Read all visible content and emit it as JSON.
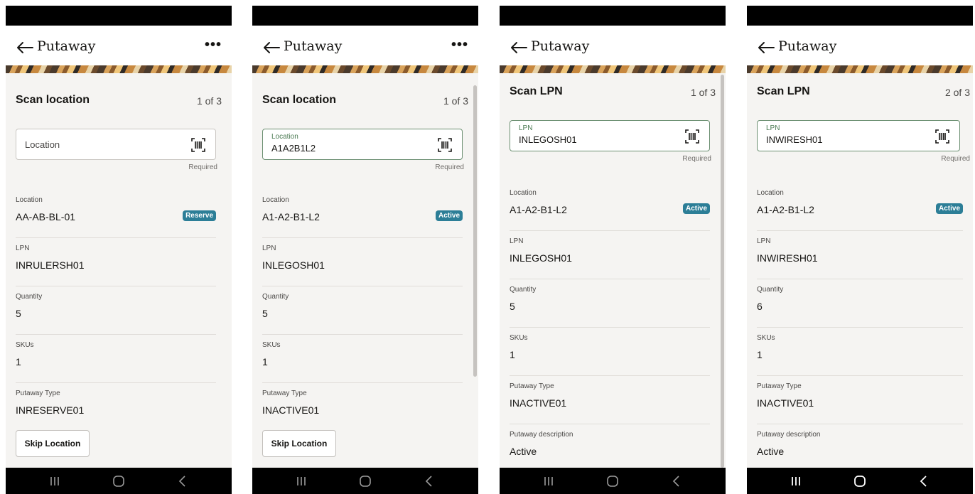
{
  "screens": [
    {
      "header_title": "Putaway",
      "step_title": "Scan location",
      "step_count": "1 of 3",
      "field_placeholder": "Location",
      "field_label": "",
      "field_value": "",
      "required_text": "Required",
      "details": [
        {
          "label": "Location",
          "value": "AA-AB-BL-01",
          "badge": "Reserve"
        },
        {
          "label": "LPN",
          "value": "INRULERSH01"
        },
        {
          "label": "Quantity",
          "value": "5"
        },
        {
          "label": "SKUs",
          "value": "1"
        },
        {
          "label": "Putaway Type",
          "value": "INRESERVE01"
        }
      ],
      "skip_label": "Skip Location"
    },
    {
      "header_title": "Putaway",
      "step_title": "Scan location",
      "step_count": "1 of 3",
      "field_placeholder": "",
      "field_label": "Location",
      "field_value": "A1A2B1L2",
      "required_text": "Required",
      "details": [
        {
          "label": "Location",
          "value": "A1-A2-B1-L2",
          "badge": "Active"
        },
        {
          "label": "LPN",
          "value": "INLEGOSH01"
        },
        {
          "label": "Quantity",
          "value": "5"
        },
        {
          "label": "SKUs",
          "value": "1"
        },
        {
          "label": "Putaway Type",
          "value": "INACTIVE01"
        }
      ],
      "skip_label": "Skip Location"
    },
    {
      "header_title": "Putaway",
      "step_title": "Scan LPN",
      "step_count": "1 of 3",
      "field_placeholder": "",
      "field_label": "LPN",
      "field_value": "INLEGOSH01",
      "required_text": "Required",
      "details": [
        {
          "label": "Location",
          "value": "A1-A2-B1-L2",
          "badge": "Active"
        },
        {
          "label": "LPN",
          "value": "INLEGOSH01"
        },
        {
          "label": "Quantity",
          "value": "5"
        },
        {
          "label": "SKUs",
          "value": "1"
        },
        {
          "label": "Putaway Type",
          "value": "INACTIVE01"
        },
        {
          "label": "Putaway description",
          "value": "Active"
        }
      ],
      "skip_label": ""
    },
    {
      "header_title": "Putaway",
      "step_title": "Scan LPN",
      "step_count": "2 of 3",
      "field_placeholder": "",
      "field_label": "LPN",
      "field_value": "INWIRESH01",
      "required_text": "Required",
      "details": [
        {
          "label": "Location",
          "value": "A1-A2-B1-L2",
          "badge": "Active"
        },
        {
          "label": "LPN",
          "value": "INWIRESH01"
        },
        {
          "label": "Quantity",
          "value": "6"
        },
        {
          "label": "SKUs",
          "value": "1"
        },
        {
          "label": "Putaway Type",
          "value": "INACTIVE01"
        },
        {
          "label": "Putaway description",
          "value": "Active"
        }
      ],
      "skip_label": ""
    }
  ],
  "colors": {
    "badge": "#2c7e97",
    "focus_border": "#6b8f71",
    "background": "#f5f4f2"
  },
  "icons": [
    "back-arrow-icon",
    "more-icon",
    "barcode-scan-icon",
    "recent-apps-icon",
    "home-icon",
    "nav-back-icon"
  ]
}
